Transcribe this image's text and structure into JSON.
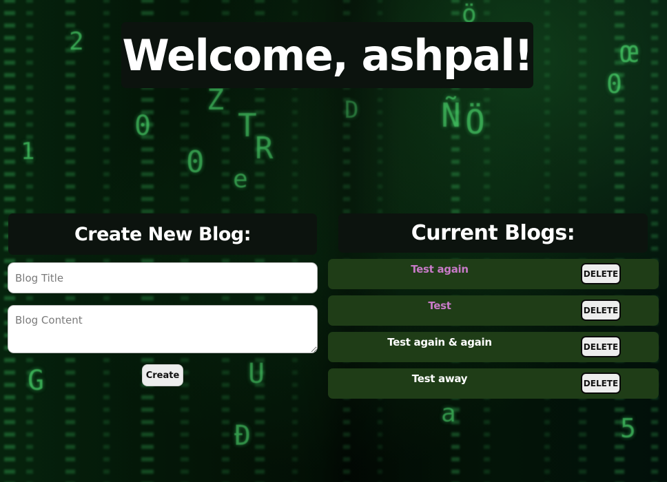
{
  "header": {
    "welcome_text": "Welcome, ashpal!"
  },
  "create_section": {
    "heading": "Create New Blog:",
    "title_placeholder": "Blog Title",
    "title_value": "",
    "content_placeholder": "Blog Content",
    "content_value": "",
    "create_label": "Create"
  },
  "current_section": {
    "heading": "Current Blogs:",
    "blogs": [
      {
        "title": "Test again",
        "title_color": "#c77ac7",
        "delete_label": "DELETE"
      },
      {
        "title": "Test",
        "title_color": "#c77ac7",
        "delete_label": "DELETE"
      },
      {
        "title": "Test again & again",
        "title_color": "#ffffff",
        "delete_label": "DELETE"
      },
      {
        "title": "Test away",
        "title_color": "#ffffff",
        "delete_label": "DELETE"
      }
    ]
  },
  "theme": {
    "panel_bg": "#0c130e",
    "blog_item_bg": "#1f3d17",
    "matrix_green": "#46dc6e"
  }
}
